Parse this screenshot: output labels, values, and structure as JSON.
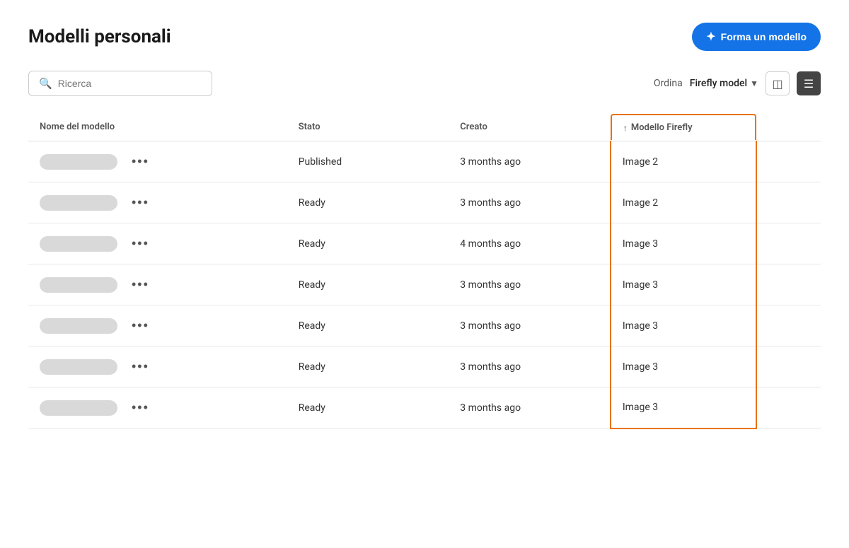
{
  "header": {
    "title": "Modelli personali",
    "cta_label": "Forma un modello"
  },
  "toolbar": {
    "search_placeholder": "Ricerca",
    "sort_label": "Ordina",
    "sort_value": "Firefly model",
    "view_grid_label": "Grid view",
    "view_list_label": "List view"
  },
  "table": {
    "columns": {
      "name": "Nome del modello",
      "stato": "Stato",
      "creato": "Creato",
      "firefly": "Modello Firefly"
    },
    "rows": [
      {
        "stato": "Published",
        "creato": "3 months ago",
        "firefly": "Image 2"
      },
      {
        "stato": "Ready",
        "creato": "3 months ago",
        "firefly": "Image 2"
      },
      {
        "stato": "Ready",
        "creato": "4 months ago",
        "firefly": "Image 3"
      },
      {
        "stato": "Ready",
        "creato": "3 months ago",
        "firefly": "Image 3"
      },
      {
        "stato": "Ready",
        "creato": "3 months ago",
        "firefly": "Image 3"
      },
      {
        "stato": "Ready",
        "creato": "3 months ago",
        "firefly": "Image 3"
      },
      {
        "stato": "Ready",
        "creato": "3 months ago",
        "firefly": "Image 3"
      }
    ]
  },
  "colors": {
    "orange_border": "#e8720c",
    "blue_btn": "#1473e6"
  }
}
